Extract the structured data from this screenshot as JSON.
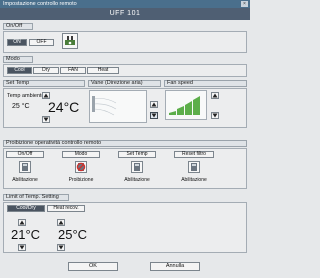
{
  "window": {
    "title": "Impostazione controllo remoto",
    "close_glyph": "×",
    "unit_name": "UFF 101"
  },
  "onoff": {
    "section_title": "On/Off",
    "on_label": "ON",
    "off_label": "OFF",
    "icon": "power-plug-icon"
  },
  "mode": {
    "section_title": "Modo",
    "buttons": [
      {
        "label": "Cool"
      },
      {
        "label": "Dry"
      },
      {
        "label": "FAN"
      },
      {
        "label": "Heat"
      }
    ]
  },
  "set_temp": {
    "section_title": "Set Temp",
    "ambient_label": "Temp ambiente",
    "ambient_value": "25 °C",
    "set_value": "24°C"
  },
  "vane": {
    "section_title": "Vane (Direzione aria)"
  },
  "fan_speed": {
    "section_title": "Fan speed"
  },
  "prohibition": {
    "section_title": "Proibizione operatività controllo remoto",
    "items": [
      {
        "label": "On/Off",
        "status": "Abilitazione"
      },
      {
        "label": "Modo",
        "status": "Proibizione"
      },
      {
        "label": "Set Temp",
        "status": "Abilitazione"
      },
      {
        "label": "Reset filtro",
        "status": "Abilitazione"
      }
    ]
  },
  "limit": {
    "section_title": "Limit of Temp. Setting",
    "cool_label": "Cool/Dry",
    "heat_label": "Heat recov.",
    "cool_value": "21°C",
    "heat_value": "25°C"
  },
  "footer": {
    "ok_label": "OK",
    "cancel_label": "Annulla"
  },
  "colors": {
    "titlebar": "#4a6f8c",
    "unitbar": "#4f5f73",
    "background": "#e6e8ea",
    "fan_green": "#5cae4a",
    "prohibit_red": "#d0302c"
  }
}
